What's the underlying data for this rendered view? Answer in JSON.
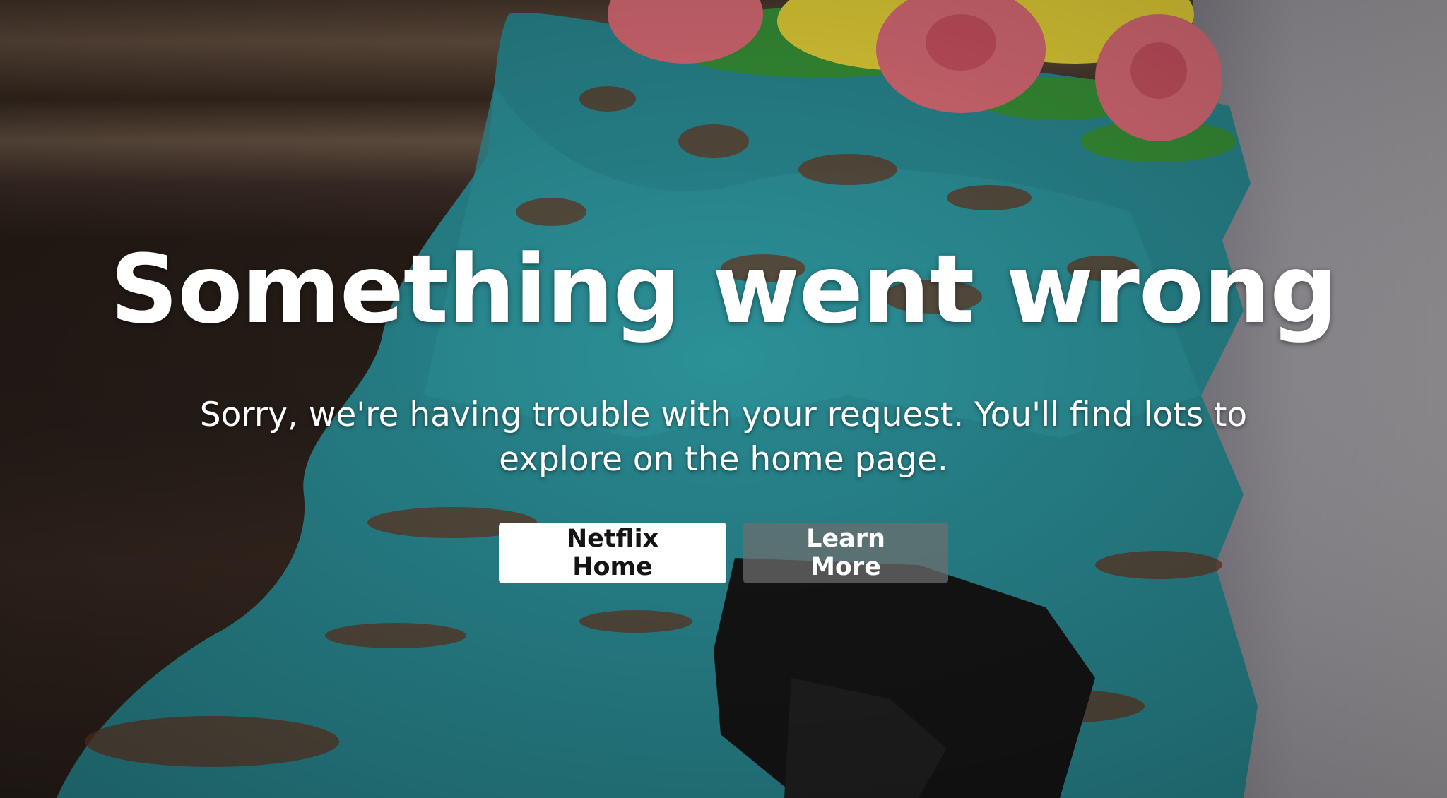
{
  "error": {
    "headline": "Something went wrong",
    "message": "Sorry, we're having trouble with your request. You'll find lots to explore on the home page."
  },
  "actions": {
    "home_label": "Netflix Home",
    "learn_more_label": "Learn More"
  },
  "background": {
    "description_icon": "cake-photo-image"
  },
  "colors": {
    "primary_button_bg": "#ffffff",
    "primary_button_text": "#141414",
    "secondary_button_bg": "#6d6d6e",
    "text": "#ffffff"
  }
}
